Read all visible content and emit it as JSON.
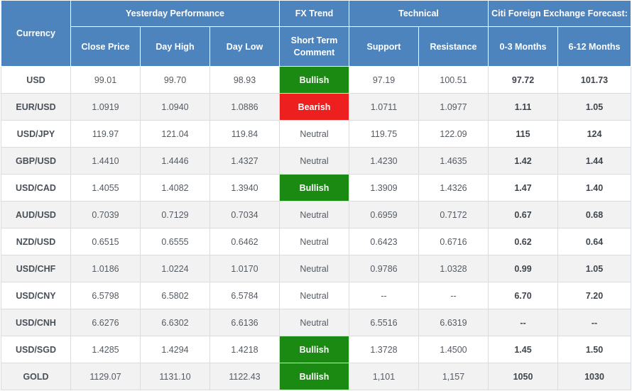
{
  "header": {
    "currency": "Currency",
    "yesterday": "Yesterday Performance",
    "fx_trend": "FX Trend",
    "technical": "Technical",
    "forecast": "Citi Foreign Exchange Forecast:",
    "close": "Close Price",
    "high": "Day High",
    "low": "Day Low",
    "short_term": "Short Term Comment",
    "support": "Support",
    "resistance": "Resistance",
    "m0_3": "0-3 Months",
    "m6_12": "6-12 Months"
  },
  "colors": {
    "header_bg": "#4e84bd",
    "bullish": "#1a8a12",
    "bearish": "#ee1f1f"
  },
  "rows": [
    {
      "currency": "USD",
      "close": "99.01",
      "high": "99.70",
      "low": "98.93",
      "trend": "Bullish",
      "support": "97.19",
      "resistance": "100.51",
      "m0_3": "97.72",
      "m6_12": "101.73"
    },
    {
      "currency": "EUR/USD",
      "close": "1.0919",
      "high": "1.0940",
      "low": "1.0886",
      "trend": "Bearish",
      "support": "1.0711",
      "resistance": "1.0977",
      "m0_3": "1.11",
      "m6_12": "1.05"
    },
    {
      "currency": "USD/JPY",
      "close": "119.97",
      "high": "121.04",
      "low": "119.84",
      "trend": "Neutral",
      "support": "119.75",
      "resistance": "122.09",
      "m0_3": "115",
      "m6_12": "124"
    },
    {
      "currency": "GBP/USD",
      "close": "1.4410",
      "high": "1.4446",
      "low": "1.4327",
      "trend": "Neutral",
      "support": "1.4230",
      "resistance": "1.4635",
      "m0_3": "1.42",
      "m6_12": "1.44"
    },
    {
      "currency": "USD/CAD",
      "close": "1.4055",
      "high": "1.4082",
      "low": "1.3940",
      "trend": "Bullish",
      "support": "1.3909",
      "resistance": "1.4326",
      "m0_3": "1.47",
      "m6_12": "1.40"
    },
    {
      "currency": "AUD/USD",
      "close": "0.7039",
      "high": "0.7129",
      "low": "0.7034",
      "trend": "Neutral",
      "support": "0.6959",
      "resistance": "0.7172",
      "m0_3": "0.67",
      "m6_12": "0.68"
    },
    {
      "currency": "NZD/USD",
      "close": "0.6515",
      "high": "0.6555",
      "low": "0.6462",
      "trend": "Neutral",
      "support": "0.6423",
      "resistance": "0.6716",
      "m0_3": "0.62",
      "m6_12": "0.64"
    },
    {
      "currency": "USD/CHF",
      "close": "1.0186",
      "high": "1.0224",
      "low": "1.0170",
      "trend": "Neutral",
      "support": "0.9786",
      "resistance": "1.0328",
      "m0_3": "0.99",
      "m6_12": "1.05"
    },
    {
      "currency": "USD/CNY",
      "close": "6.5798",
      "high": "6.5802",
      "low": "6.5784",
      "trend": "Neutral",
      "support": "--",
      "resistance": "--",
      "m0_3": "6.70",
      "m6_12": "7.20"
    },
    {
      "currency": "USD/CNH",
      "close": "6.6276",
      "high": "6.6302",
      "low": "6.6136",
      "trend": "Neutral",
      "support": "6.5516",
      "resistance": "6.6319",
      "m0_3": "--",
      "m6_12": "--"
    },
    {
      "currency": "USD/SGD",
      "close": "1.4285",
      "high": "1.4294",
      "low": "1.4218",
      "trend": "Bullish",
      "support": "1.3728",
      "resistance": "1.4500",
      "m0_3": "1.45",
      "m6_12": "1.50"
    },
    {
      "currency": "GOLD",
      "close": "1129.07",
      "high": "1131.10",
      "low": "1122.43",
      "trend": "Bullish",
      "support": "1,101",
      "resistance": "1,157",
      "m0_3": "1050",
      "m6_12": "1030"
    }
  ]
}
